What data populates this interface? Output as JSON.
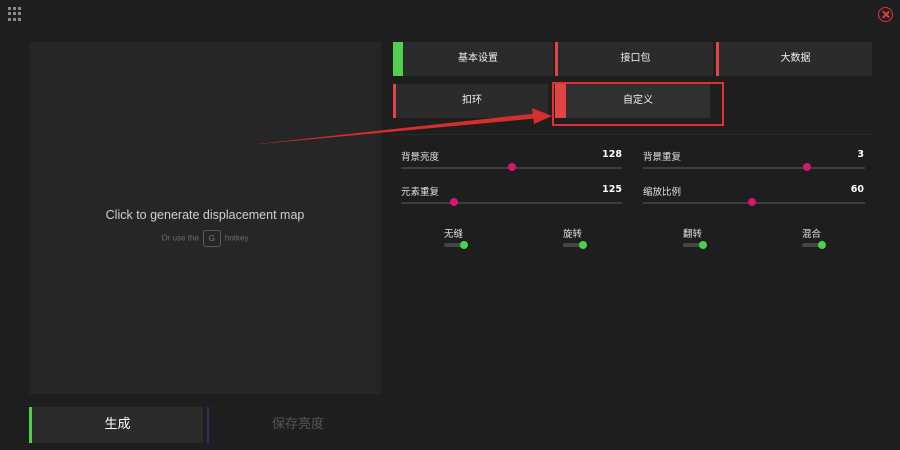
{
  "preview": {
    "message": "Click to generate displacement map",
    "hotkey_prefix": "Or use the",
    "hotkey_key": "G",
    "hotkey_suffix": "hotkey"
  },
  "bottom": {
    "generate_label": "生成",
    "save_label": "保存亮度"
  },
  "tabs": [
    {
      "label": "基本设置"
    },
    {
      "label": "接口包"
    },
    {
      "label": "大数据"
    },
    {
      "label": "扣环"
    },
    {
      "label": "自定义"
    }
  ],
  "sliders": [
    {
      "label": "背景亮度",
      "value": "128",
      "fraction": 0.5
    },
    {
      "label": "背景重复",
      "value": "3",
      "fraction": 0.74
    },
    {
      "label": "元素重复",
      "value": "125",
      "fraction": 0.24
    },
    {
      "label": "缩放比例",
      "value": "60",
      "fraction": 0.49
    }
  ],
  "toggles": [
    {
      "label": "无缝",
      "on": true
    },
    {
      "label": "旋转",
      "on": true
    },
    {
      "label": "翻转",
      "on": true
    },
    {
      "label": "混合",
      "on": true
    }
  ],
  "colors": {
    "accent_green": "#4fd14f",
    "accent_red": "#e04444",
    "slider_thumb": "#d4166e",
    "close": "#e0393e"
  }
}
